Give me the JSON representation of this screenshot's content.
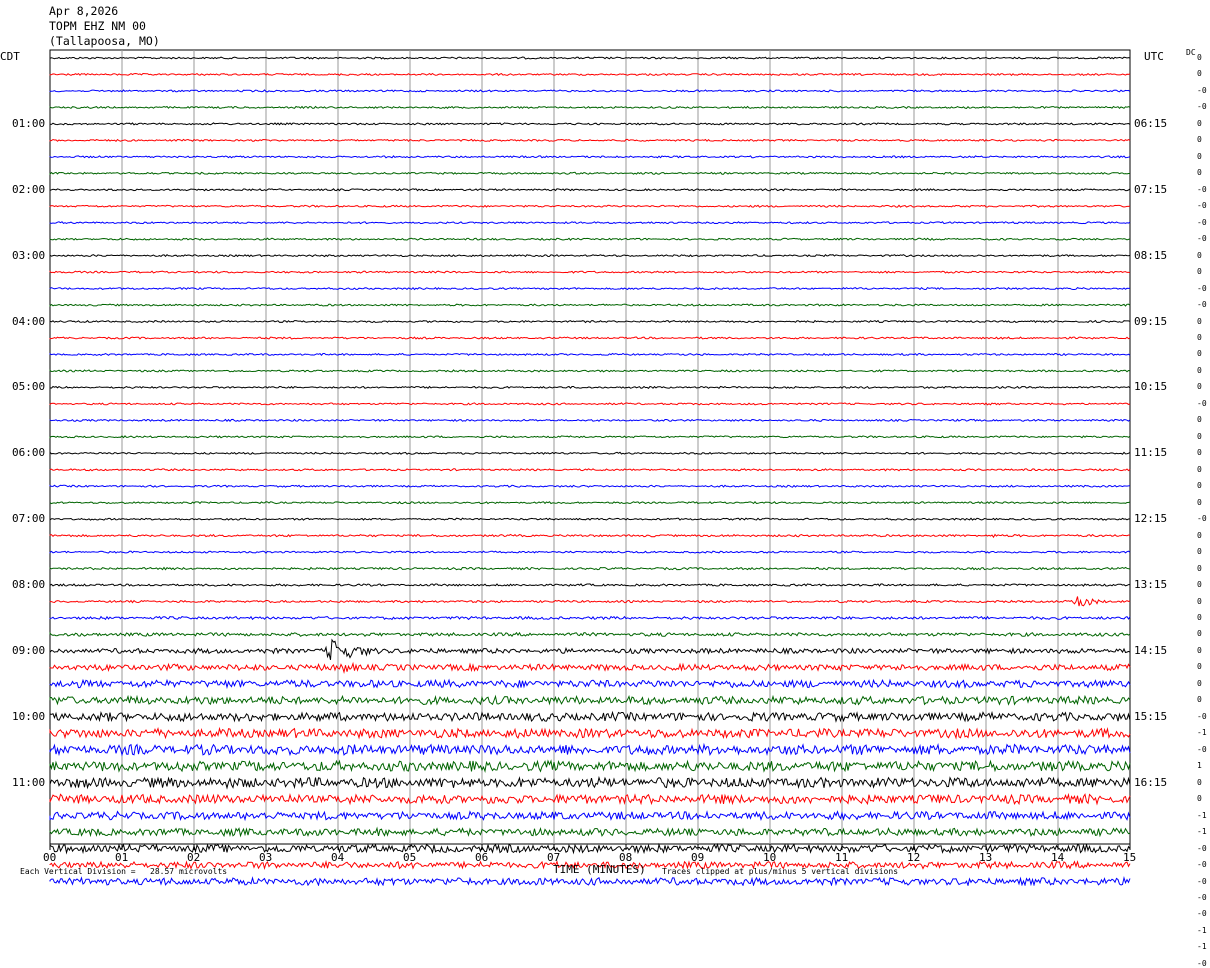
{
  "header": {
    "date": "Apr 8,2026",
    "station": "TOPM EHZ NM 00",
    "location": "(Tallapoosa, MO)"
  },
  "axis": {
    "left_tz": "CDT",
    "right_tz": "UTC",
    "dc_label": "DC",
    "x_title": "TIME (MINUTES)",
    "x_ticks": [
      "00",
      "01",
      "02",
      "03",
      "04",
      "05",
      "06",
      "07",
      "08",
      "09",
      "10",
      "11",
      "12",
      "13",
      "14",
      "15"
    ]
  },
  "footer": {
    "scale_note": "Each Vertical Division =   28.57 microvolts",
    "clip_note": "Traces clipped at plus/minus 5 vertical divisions"
  },
  "chart_data": {
    "type": "line",
    "title": "TOPM EHZ NM 00",
    "xlabel": "TIME (MINUTES)",
    "xlim": [
      0,
      15
    ],
    "trace_colors": [
      "#000000",
      "#ff0000",
      "#0000ff",
      "#006400"
    ],
    "left_time_labels": [
      "01:00",
      "02:00",
      "03:00",
      "04:00",
      "05:00",
      "06:00",
      "07:00",
      "08:00",
      "09:00",
      "10:00",
      "11:00"
    ],
    "right_time_labels": [
      "06:15",
      "07:15",
      "08:15",
      "09:15",
      "10:15",
      "11:15",
      "12:15",
      "13:15",
      "14:15",
      "15:15",
      "16:15"
    ],
    "dc_offsets": [
      "0",
      "0",
      "-0",
      "-0",
      "0",
      "0",
      "0",
      "0",
      "-0",
      "-0",
      "-0",
      "-0",
      "0",
      "0",
      "-0",
      "-0",
      "0",
      "0",
      "0",
      "0",
      "0",
      "-0",
      "0",
      "0",
      "0",
      "0",
      "0",
      "0",
      "-0",
      "0",
      "0",
      "0",
      "0",
      "0",
      "0",
      "0",
      "0",
      "0",
      "0",
      "0",
      "-0",
      "-1",
      "-0",
      "1",
      "0",
      "0",
      "-1",
      "-1",
      "-0",
      "-0",
      "-0",
      "-0",
      "-0",
      "-1",
      "-1",
      "-0"
    ],
    "amplitudes": [
      0.6,
      0.6,
      0.6,
      0.6,
      0.6,
      0.6,
      0.6,
      0.6,
      0.6,
      0.6,
      0.6,
      0.6,
      0.6,
      0.6,
      0.6,
      0.6,
      0.6,
      0.6,
      0.6,
      0.6,
      0.6,
      0.6,
      0.6,
      0.6,
      0.6,
      0.6,
      0.6,
      0.6,
      0.6,
      0.7,
      0.6,
      0.7,
      0.7,
      0.7,
      0.9,
      1.1,
      1.6,
      2.0,
      2.4,
      2.6,
      2.8,
      3.0,
      3.3,
      3.3,
      3.3,
      3.0,
      2.6,
      2.4,
      2.6,
      2.2,
      2.4,
      3.0,
      3.0,
      3.0,
      2.8,
      2.2
    ],
    "events": [
      {
        "trace": 29,
        "minute_start": 13.0,
        "minute_end": 13.6,
        "amplitude": 3
      },
      {
        "trace": 33,
        "minute_start": 14.2,
        "minute_end": 14.8,
        "amplitude": 12
      },
      {
        "trace": 36,
        "minute_start": 3.8,
        "minute_end": 5.1,
        "amplitude": 16
      },
      {
        "trace": 37,
        "minute_start": 4.0,
        "minute_end": 4.9,
        "amplitude": 8
      },
      {
        "trace": 42,
        "minute_start": 2.3,
        "minute_end": 2.6,
        "amplitude": 9
      },
      {
        "trace": 42,
        "minute_start": 3.2,
        "minute_end": 3.6,
        "amplitude": 7
      },
      {
        "trace": 46,
        "minute_start": 9.1,
        "minute_end": 9.4,
        "amplitude": 7
      },
      {
        "trace": 47,
        "minute_start": 14.6,
        "minute_end": 15.0,
        "amplitude": 8
      }
    ]
  }
}
